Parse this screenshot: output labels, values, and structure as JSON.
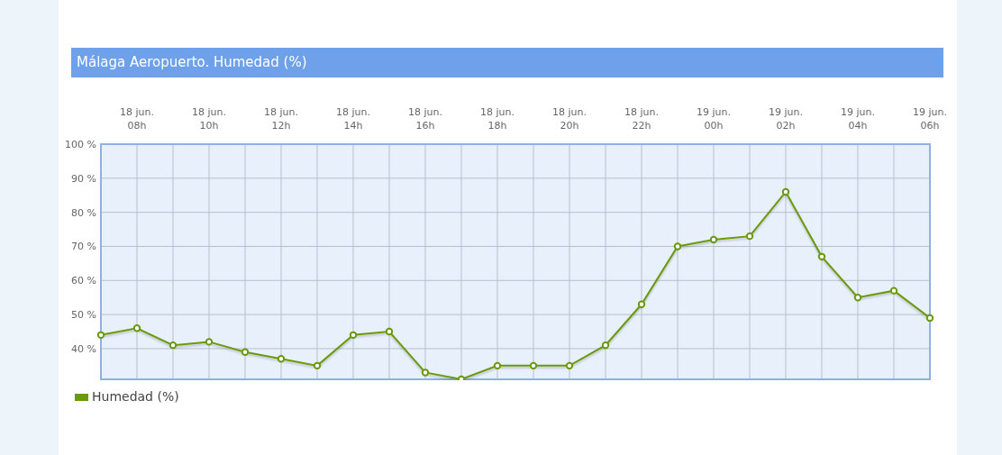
{
  "panel": {
    "title": "Málaga Aeropuerto. Humedad (%)"
  },
  "chart_data": {
    "type": "line",
    "categories": [
      null,
      "18 jun. 08h",
      null,
      "18 jun. 10h",
      null,
      "18 jun. 12h",
      null,
      "18 jun. 14h",
      null,
      "18 jun. 16h",
      null,
      "18 jun. 18h",
      null,
      "18 jun. 20h",
      null,
      "18 jun. 22h",
      null,
      "19 jun. 00h",
      null,
      "19 jun. 02h",
      null,
      "19 jun. 04h",
      null,
      "19 jun. 06h"
    ],
    "grid": true,
    "series": [
      {
        "name": "Humedad (%)",
        "color": "#6a9a0a",
        "marker": "circle",
        "values": [
          44,
          46,
          41,
          42,
          39,
          37,
          35,
          44,
          45,
          33,
          31,
          35,
          35,
          35,
          41,
          53,
          70,
          72,
          73,
          86,
          67,
          55,
          57,
          49
        ]
      }
    ],
    "ylim": [
      31,
      100
    ],
    "yticks": [
      {
        "value": 40,
        "label": "40 %"
      },
      {
        "value": 50,
        "label": "50 %"
      },
      {
        "value": 60,
        "label": "60 %"
      },
      {
        "value": 70,
        "label": "70 %"
      },
      {
        "value": 80,
        "label": "80 %"
      },
      {
        "value": 90,
        "label": "90 %"
      },
      {
        "value": 100,
        "label": "100 %"
      }
    ]
  }
}
